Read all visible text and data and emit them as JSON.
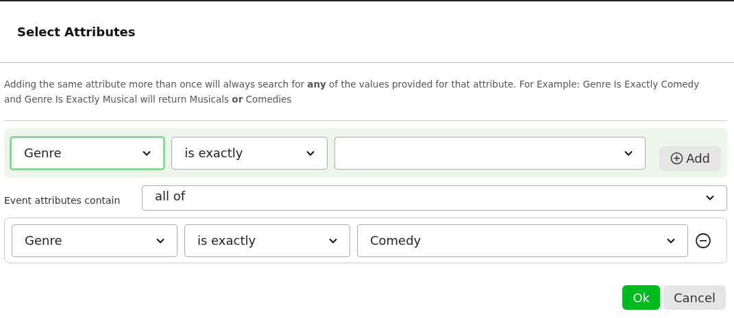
{
  "dialog": {
    "title": "Select Attributes"
  },
  "description": "Adding the same attribute more than once will always search for **any** of the values provided for that attribute. For Example: Genre Is Exactly Comedy and Genre Is Exactly Musical will return Musicals **or** Comedies",
  "builder": {
    "selects": [
      {
        "value": "Genre",
        "focused": true
      },
      {
        "value": "is exactly",
        "focused": false
      },
      {
        "focused": false
      }
    ],
    "add_button": "Add"
  },
  "match": {
    "label": "Event attributes contain",
    "value": "all of"
  },
  "conditions": [
    {
      "attribute": "Genre",
      "operator": "is exactly",
      "value": "Comedy"
    }
  ],
  "buttons": [
    {
      "label": "Ok",
      "kind": "primary"
    },
    {
      "label": "Cancel",
      "kind": "secondary"
    }
  ]
}
